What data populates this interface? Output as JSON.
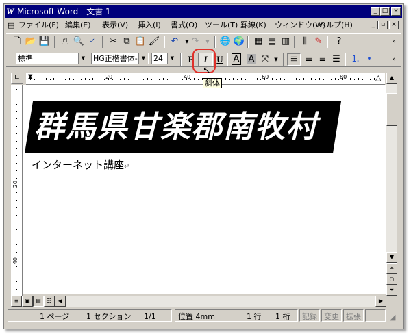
{
  "window": {
    "title": "Microsoft Word - 文書 1",
    "logo": "W"
  },
  "menu": [
    "ファイル(F)",
    "編集(E)",
    "表示(V)",
    "挿入(I)",
    "書式(O)",
    "ツール(T)",
    "罫線(K)",
    "ウィンドウ(W)",
    "ヘルプ(H)"
  ],
  "formatting": {
    "style": "標準",
    "font": "HG正楷書体-PRO",
    "size": "24",
    "bold": "B",
    "italic": "I",
    "underline": "U",
    "charborder": "A",
    "charshade": "A"
  },
  "tooltip": "斜体",
  "ruler": {
    "labels": [
      "20",
      "40",
      "60",
      "80"
    ]
  },
  "vruler": {
    "labels": [
      "20",
      "40"
    ]
  },
  "document": {
    "heading": "群馬県甘楽郡南牧村",
    "line2": "インターネット講座"
  },
  "status": {
    "page": "1 ページ",
    "section": "1 セクション",
    "pages": "1/1",
    "position": "位置 4mm",
    "line": "1 行",
    "col": "1 桁",
    "rec": "記録",
    "trk": "変更",
    "ext": "拡張"
  }
}
